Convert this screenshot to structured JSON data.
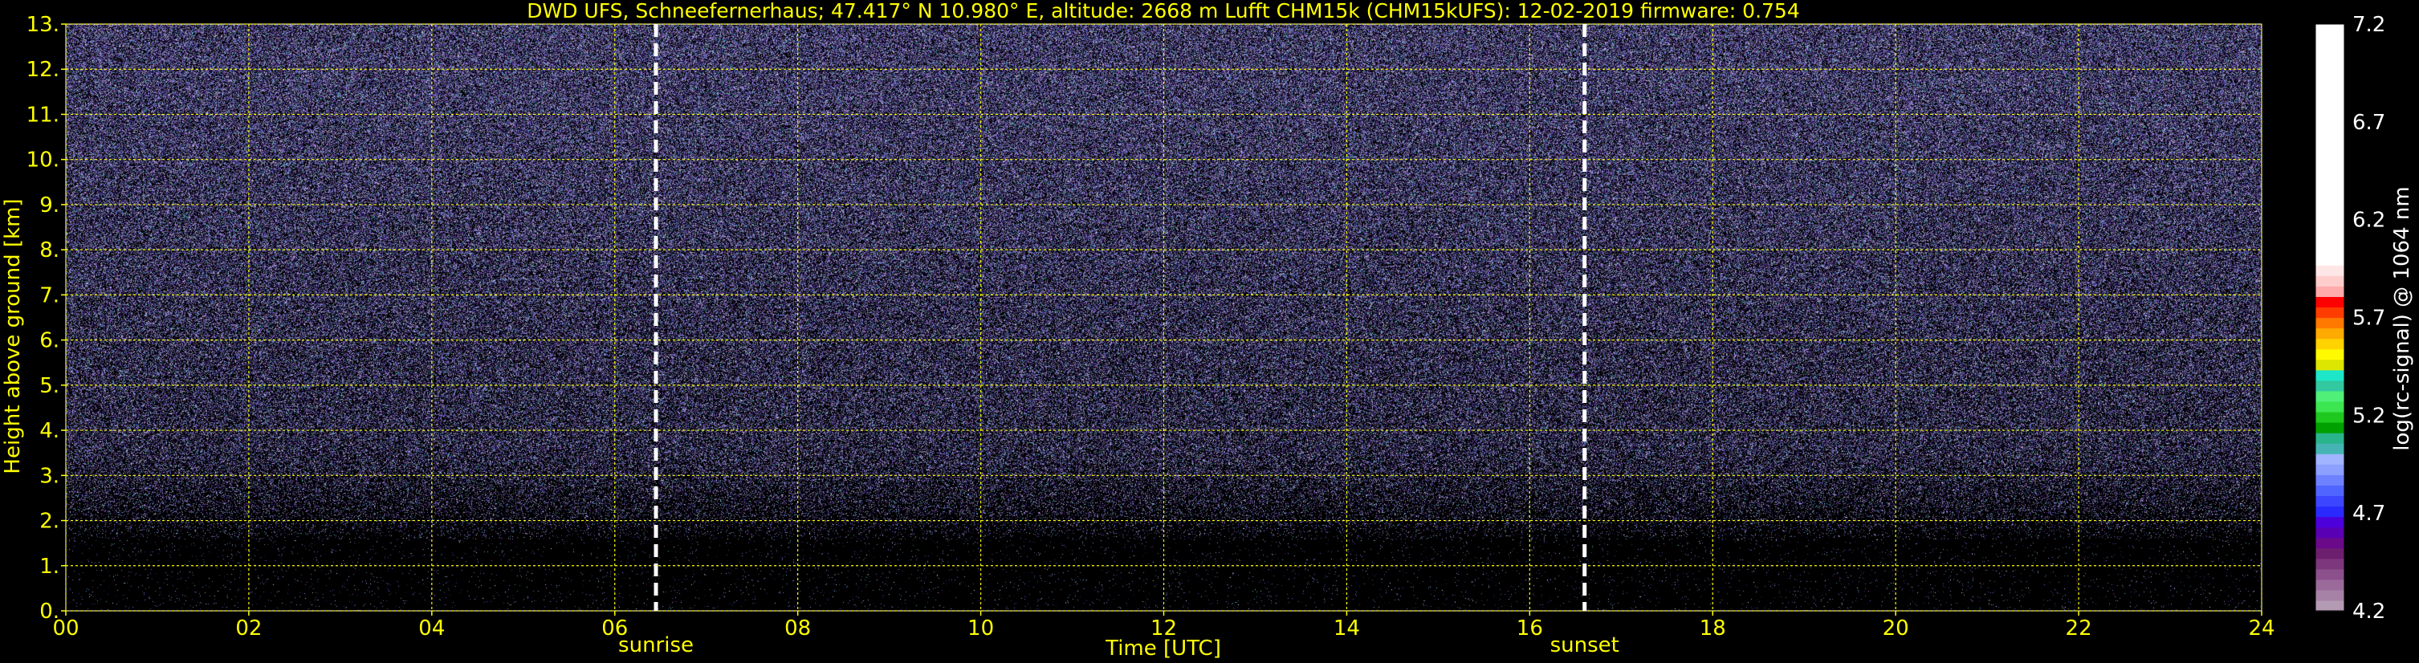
{
  "chart_data": {
    "type": "heatmap",
    "title": "DWD UFS, Schneefernerhaus; 47.417° N 10.980° E, altitude: 2668 m    Lufft CHM15k (CHM15kUFS): 12-02-2019    firmware: 0.754",
    "xlabel": "Time [UTC]",
    "ylabel": "Height above ground [km]",
    "xlim": [
      0,
      24
    ],
    "ylim": [
      0,
      13
    ],
    "x_ticks": [
      "00",
      "02",
      "04",
      "06",
      "08",
      "10",
      "12",
      "14",
      "16",
      "18",
      "20",
      "22",
      "24"
    ],
    "x_tick_values": [
      0,
      2,
      4,
      6,
      8,
      10,
      12,
      14,
      16,
      18,
      20,
      22,
      24
    ],
    "y_ticks": [
      "0.",
      "1.",
      "2.",
      "3.",
      "4.",
      "5.",
      "6.",
      "7.",
      "8.",
      "9.",
      "10.",
      "11.",
      "12.",
      "13."
    ],
    "y_tick_values": [
      0,
      1,
      2,
      3,
      4,
      5,
      6,
      7,
      8,
      9,
      10,
      11,
      12,
      13
    ],
    "grid": true,
    "grid_color": "#ffff00",
    "annotations": [
      {
        "label": "sunrise",
        "x": 6.45
      },
      {
        "label": "sunset",
        "x": 16.6
      }
    ],
    "colorbar": {
      "label": "log(rc-signal) @ 1064 nm",
      "range": [
        4.2,
        7.2
      ],
      "tick_labels": [
        "4.2",
        "4.7",
        "5.2",
        "5.7",
        "6.2",
        "6.7",
        "7.2"
      ],
      "tick_values": [
        4.2,
        4.7,
        5.2,
        5.7,
        6.2,
        6.7,
        7.2
      ],
      "colors": [
        "#b49bb4",
        "#a782a7",
        "#9a6a9a",
        "#8c508c",
        "#7d377d",
        "#6e1e6e",
        "#6a0a8a",
        "#5a00b4",
        "#4b00dc",
        "#2a2aff",
        "#3c46ff",
        "#5064ff",
        "#6e82ff",
        "#8ca0ff",
        "#a0b4ff",
        "#46b4b4",
        "#2ab48c",
        "#00a000",
        "#1ec81e",
        "#3ce650",
        "#50f078",
        "#32c8a0",
        "#1ee6c8",
        "#dce600",
        "#fffa00",
        "#ffd200",
        "#ffaa00",
        "#ff7800",
        "#ff3c00",
        "#ff0000",
        "#ffaaaa",
        "#ffcccc",
        "#ffe6e6",
        "#ffffff",
        "#ffffff",
        "#ffffff",
        "#ffffff",
        "#ffffff",
        "#ffffff",
        "#ffffff",
        "#ffffff",
        "#ffffff",
        "#ffffff",
        "#ffffff",
        "#ffffff",
        "#ffffff",
        "#ffffff",
        "#ffffff",
        "#ffffff",
        "#ffffff",
        "#ffffff",
        "#ffffff",
        "#ffffff",
        "#ffffff",
        "#ffffff",
        "#ffffff"
      ]
    },
    "description_of_field": "noise-dominated backscatter, mostly purple/blue speckle above ~2 km, near-black below",
    "text_color": "#ffff00",
    "colorbar_text_color": "#ffffff"
  }
}
